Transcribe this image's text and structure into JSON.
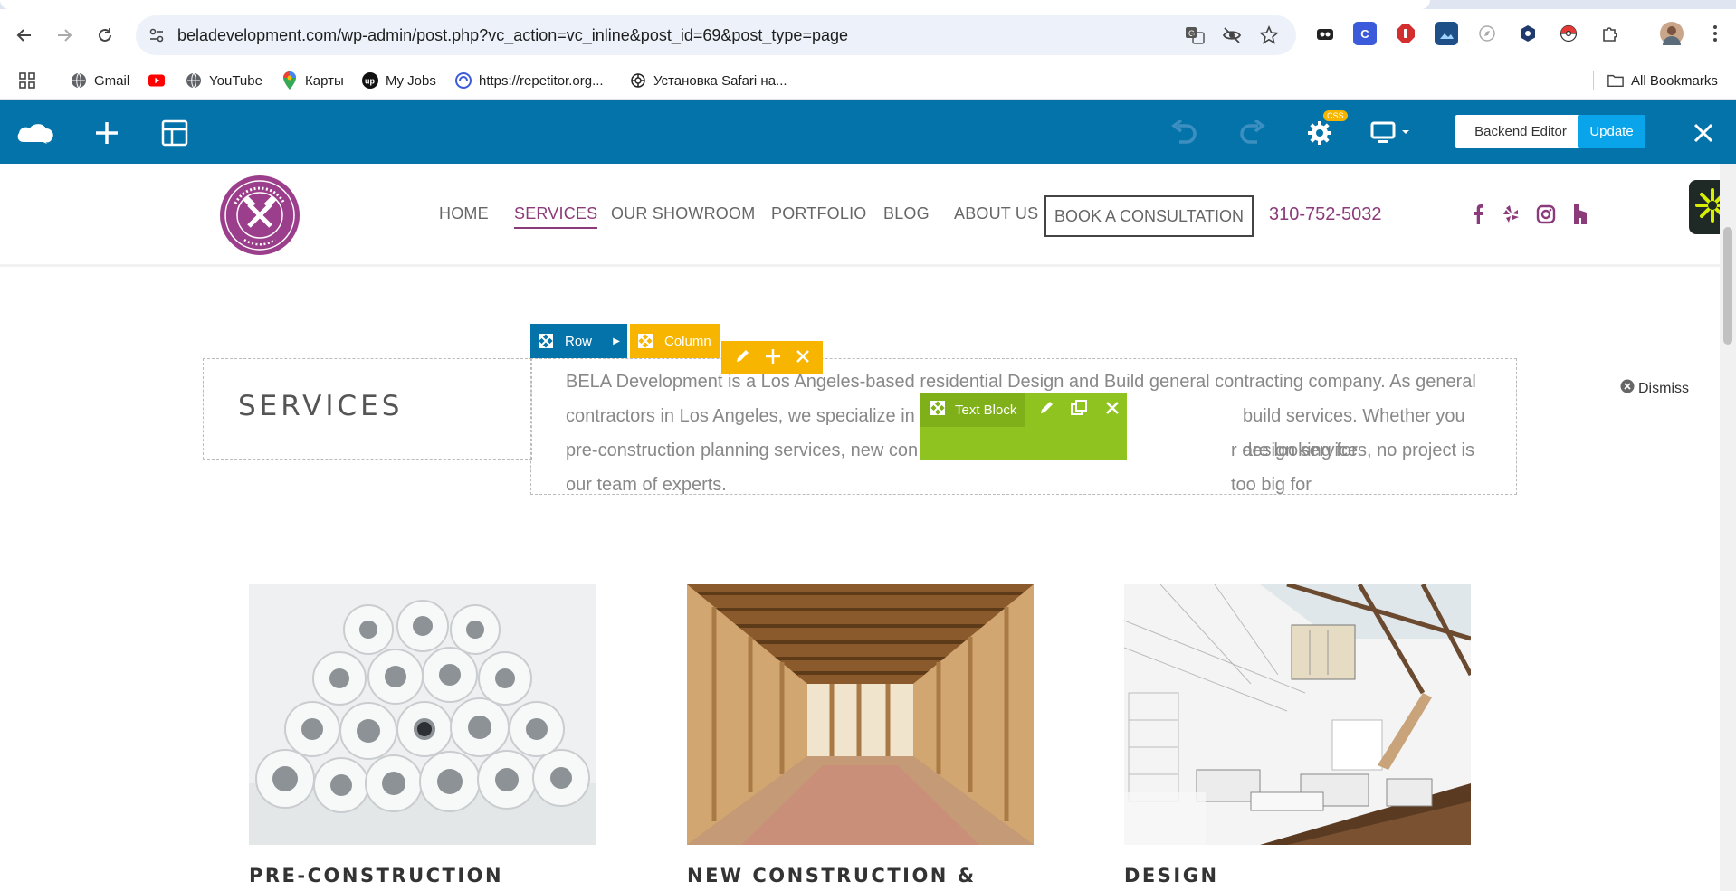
{
  "browser": {
    "url": "beladevelopment.com/wp-admin/post.php?vc_action=vc_inline&post_id=69&post_type=page",
    "bookmarks": [
      {
        "label": "Gmail",
        "icon": "globe-icon"
      },
      {
        "label": "",
        "icon": "youtube-icon"
      },
      {
        "label": "YouTube",
        "icon": "globe-icon"
      },
      {
        "label": "Карты",
        "icon": "maps-pin-icon"
      },
      {
        "label": "My Jobs",
        "icon": "upwork-icon"
      },
      {
        "label": "https://repetitor.org...",
        "icon": "repetitor-icon"
      },
      {
        "label": "Установка Safari на...",
        "icon": "chatgpt-icon"
      }
    ],
    "all_bookmarks": "All Bookmarks"
  },
  "editor": {
    "css_badge": "CSS",
    "backend_editor": "Backend Editor",
    "update": "Update",
    "controls": {
      "row": "Row",
      "column": "Column",
      "text_block": "Text Block"
    },
    "dismiss": "Dismiss"
  },
  "site": {
    "nav": [
      "HOME",
      "SERVICES",
      "OUR SHOWROOM",
      "PORTFOLIO",
      "BLOG",
      "ABOUT US"
    ],
    "active_nav": "SERVICES",
    "book_button": "BOOK A CONSULTATION",
    "phone": "310-752-5032",
    "social": [
      "facebook-icon",
      "yelp-icon",
      "instagram-icon",
      "houzz-icon"
    ],
    "accent_color": "#8b3a7a"
  },
  "content": {
    "section_title": "SERVICES",
    "body_lines": [
      "BELA Development is a Los Angeles-based residential Design and Build general contracting company. As general",
      "contractors in Los Angeles, we specialize in c",
      "pre-construction planning services, new con",
      "our team of experts."
    ],
    "body_line2_tail": "build services. Whether you are looking for",
    "body_line3_tail": "r design services, no project is too big for",
    "cards": [
      {
        "title": "PRE-CONSTRUCTION",
        "image": "rolled-blueprints-image"
      },
      {
        "title": "NEW CONSTRUCTION &",
        "image": "house-framing-image"
      },
      {
        "title": "DESIGN",
        "image": "interior-design-sketch-image"
      }
    ]
  }
}
